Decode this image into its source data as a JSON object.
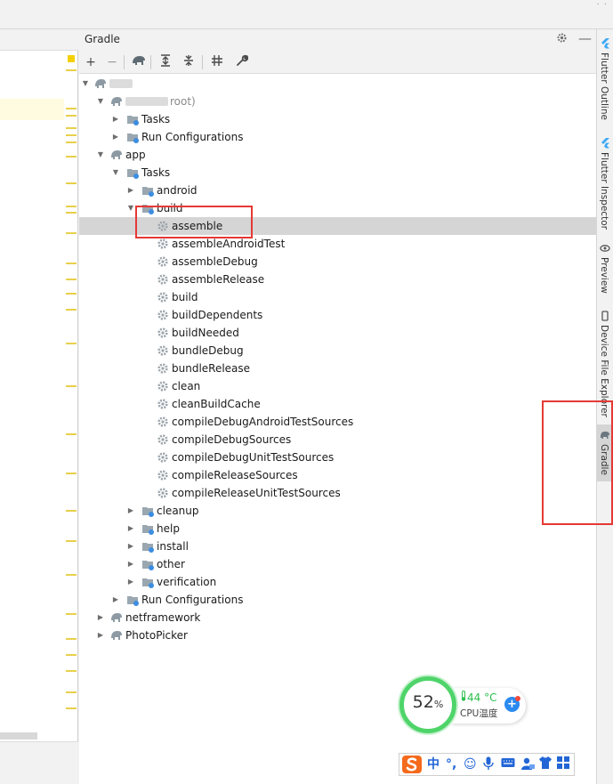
{
  "panel": {
    "title": "Gradle"
  },
  "tree": {
    "root_suffix": "root)",
    "tasks": "Tasks",
    "run_configurations": "Run Configurations",
    "app": "app",
    "app_tasks": "Tasks",
    "android": "android",
    "build_group": "build",
    "build_tasks": [
      "assemble",
      "assembleAndroidTest",
      "assembleDebug",
      "assembleRelease",
      "build",
      "buildDependents",
      "buildNeeded",
      "bundleDebug",
      "bundleRelease",
      "clean",
      "cleanBuildCache",
      "compileDebugAndroidTestSources",
      "compileDebugSources",
      "compileDebugUnitTestSources",
      "compileReleaseSources",
      "compileReleaseUnitTestSources"
    ],
    "cleanup": "cleanup",
    "help": "help",
    "install": "install",
    "other": "other",
    "verification": "verification",
    "app_run_configurations": "Run Configurations",
    "netframework": "netframework",
    "photopicker": "PhotoPicker",
    "selected": "assemble"
  },
  "side_tabs": [
    {
      "label": "Flutter Outline",
      "icon": "flutter-icon"
    },
    {
      "label": "Flutter Inspector",
      "icon": "flutter-icon"
    },
    {
      "label": "Preview",
      "icon": "eye-icon"
    },
    {
      "label": "Device File Explorer",
      "icon": "device-icon"
    },
    {
      "label": "Gradle",
      "icon": "elephant-icon"
    }
  ],
  "cpu_widget": {
    "percent": "52",
    "percent_unit": "%",
    "temperature": "44 °C",
    "label": "CPU温度"
  },
  "ime": {
    "mode": "中"
  },
  "colors": {
    "accent_red": "#e53935",
    "selection": "#d5d5d5",
    "cpu_green": "#4fd46a"
  }
}
